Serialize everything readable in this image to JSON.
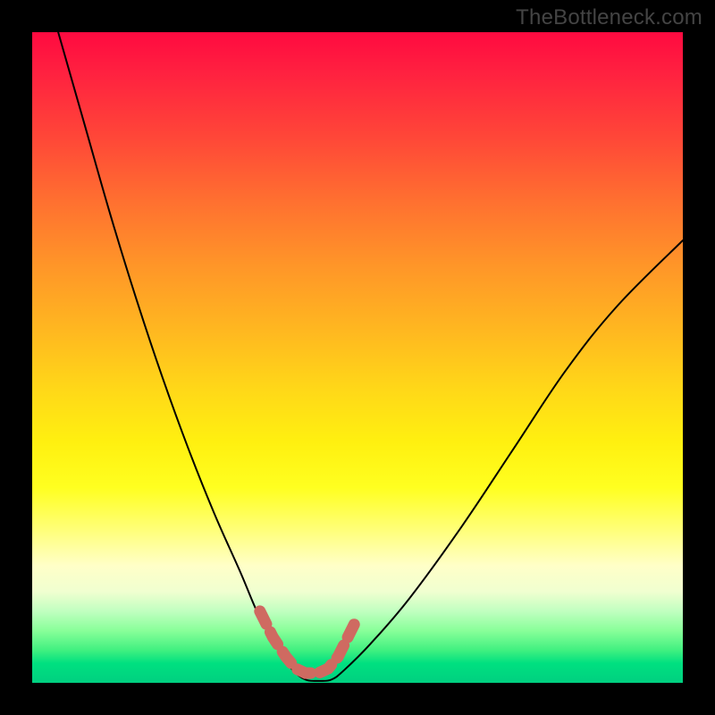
{
  "watermark": "TheBottleneck.com",
  "chart_data": {
    "type": "line",
    "title": "",
    "xlabel": "",
    "ylabel": "",
    "xlim": [
      0,
      100
    ],
    "ylim": [
      0,
      100
    ],
    "series": [
      {
        "name": "bottleneck-curve",
        "x": [
          4,
          8,
          12,
          16,
          20,
          24,
          28,
          32,
          35,
          38,
          40,
          42,
          44,
          46,
          48,
          52,
          58,
          66,
          74,
          82,
          90,
          100
        ],
        "y": [
          100,
          86,
          72,
          59,
          47,
          36,
          26,
          17,
          10,
          5,
          2,
          0.5,
          0.3,
          0.5,
          2,
          6,
          13,
          24,
          36,
          48,
          58,
          68
        ]
      }
    ],
    "highlight": {
      "name": "optimal-range-marker",
      "x": [
        35,
        37,
        39,
        40.5,
        42,
        44,
        45.5,
        47,
        48,
        49.5
      ],
      "y": [
        11,
        7,
        4,
        2.2,
        1.5,
        1.5,
        2.2,
        4,
        6,
        9
      ]
    },
    "gradient_stops": [
      {
        "pos": 0,
        "color": "#ff0a40"
      },
      {
        "pos": 50,
        "color": "#ffd818"
      },
      {
        "pos": 80,
        "color": "#ffffc8"
      },
      {
        "pos": 100,
        "color": "#00d080"
      }
    ]
  }
}
